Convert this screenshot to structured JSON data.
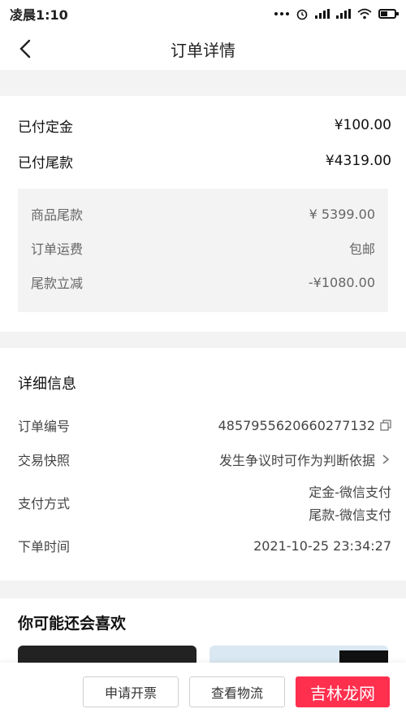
{
  "status_bar": {
    "time": "凌晨1:10"
  },
  "nav": {
    "title": "订单详情"
  },
  "payment": {
    "deposit_label": "已付定金",
    "deposit_value": "¥100.00",
    "balance_label": "已付尾款",
    "balance_value": "¥4319.00",
    "breakdown": [
      {
        "label": "商品尾款",
        "value": "¥ 5399.00"
      },
      {
        "label": "订单运费",
        "value": "包邮"
      },
      {
        "label": "尾款立减",
        "value": "-¥1080.00"
      }
    ]
  },
  "detail": {
    "title": "详细信息",
    "order_no_label": "订单编号",
    "order_no_value": "4857955620660277132",
    "snapshot_label": "交易快照",
    "snapshot_value": "发生争议时可作为判断依据",
    "pay_method_label": "支付方式",
    "pay_method_line1": "定金-微信支付",
    "pay_method_line2": "尾款-微信支付",
    "order_time_label": "下单时间",
    "order_time_value": "2021-10-25 23:34:27"
  },
  "recommend": {
    "title": "你可能还会喜欢"
  },
  "bottom": {
    "invoice_label": "申请开票",
    "logistics_label": "查看物流",
    "red_button_label": "吉林龙网"
  },
  "colors": {
    "accent": "#ff2f4e",
    "background": "#f3f3f3"
  },
  "icons": [
    "back-arrow-icon",
    "copy-icon",
    "chevron-right-icon",
    "wifi-icon",
    "signal-icon",
    "battery-icon",
    "alarm-icon"
  ]
}
